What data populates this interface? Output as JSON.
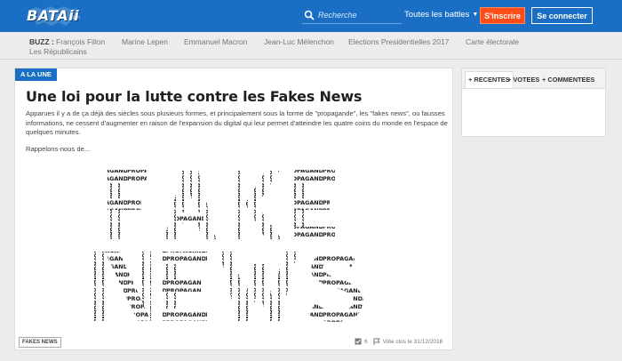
{
  "header": {
    "logo_text": "BATAii",
    "logo_sub": ".com",
    "search_placeholder": "Recherche",
    "battles_label": "Toutes les battles",
    "signup_label": "S'inscrire",
    "login_label": "Se connecter",
    "brand_color": "#1a6fc4",
    "signup_color": "#ff4d1a"
  },
  "buzz": {
    "label": "BUZZ :",
    "items": [
      "François Fillon",
      "Marine Lepen",
      "Emmanuel Macron",
      "Jean-Luc Mélenchon",
      "Elections Presidentielles 2017",
      "Carte électorale",
      "Les Républicains"
    ]
  },
  "article": {
    "tag": "A LA UNE",
    "title": "Une loi pour la lutte contre les Fakes News",
    "body": "Apparues il y a de ça déjà des siècles sous plusieurs formes, et principalement sous la forme de \"propagande\", les \"fakes news\", ou fausses informations, ne cessent d'augmenter en raison de l'expansion du digital qui leur permet d'atteindre les quatre coins du monde en l'espace de quelques minutes.",
    "more": "Rappelons-nous de...",
    "image_word": "PROPAGANDA",
    "category": "FAKES NEWS",
    "votes": "6",
    "vote_closed": "Vote clos le 31/12/2018"
  },
  "side": {
    "tabs": [
      "+ RECENTES",
      "+ VOTEES",
      "+ COMMENTEES"
    ]
  }
}
